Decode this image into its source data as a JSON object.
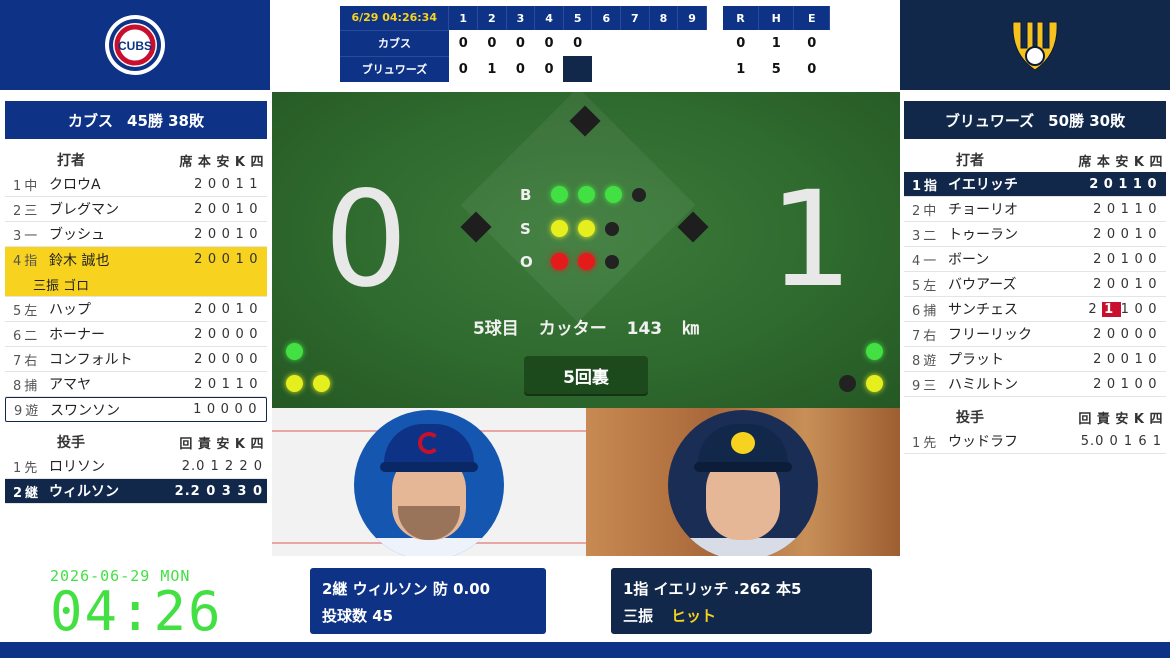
{
  "header": {
    "time": "6/29 04:26:34",
    "innings": [
      "1",
      "2",
      "3",
      "4",
      "5",
      "6",
      "7",
      "8",
      "9"
    ],
    "rhe": [
      "R",
      "H",
      "E"
    ]
  },
  "linescore": [
    {
      "team": "カブス",
      "innings": [
        "0",
        "0",
        "0",
        "0",
        "0",
        "",
        "",
        "",
        ""
      ],
      "r": "0",
      "h": "1",
      "e": "0"
    },
    {
      "team": "ブリュワーズ",
      "innings": [
        "0",
        "1",
        "0",
        "0",
        "",
        "",
        "",
        "",
        ""
      ],
      "r": "1",
      "h": "5",
      "e": "0"
    }
  ],
  "away": {
    "name": "カブス",
    "record": "45勝 38敗",
    "logo_text": "CUBS",
    "color": "#0e3386",
    "header_batter": "打者",
    "header_cols": "席 本 安 K 四",
    "batters": [
      {
        "pos": "1中",
        "name": "クロウA",
        "stats": "20011"
      },
      {
        "pos": "2三",
        "name": "ブレグマン",
        "stats": "20010"
      },
      {
        "pos": "3一",
        "name": "ブッシュ",
        "stats": "20010"
      },
      {
        "pos": "4指",
        "name": "鈴木 誠也",
        "stats": "20010"
      },
      {
        "pos": "5左",
        "name": "ハップ",
        "stats": "20010"
      },
      {
        "pos": "6二",
        "name": "ホーナー",
        "stats": "20000"
      },
      {
        "pos": "7右",
        "name": "コンフォルト",
        "stats": "20000"
      },
      {
        "pos": "8捕",
        "name": "アマヤ",
        "stats": "20110"
      },
      {
        "pos": "9遊",
        "name": "スワンソン",
        "stats": "10000"
      }
    ],
    "sub_note": "三振 ゴロ",
    "header_pitcher": "投手",
    "pitcher_cols": "回 責 安 K 四",
    "pitchers": [
      {
        "pos": "1先",
        "name": "ロリソン",
        "stats": "2.0 1 2 2 0"
      },
      {
        "pos": "2継",
        "name": "ウィルソン",
        "stats": "2.2 0 3 3 0"
      }
    ]
  },
  "home": {
    "name": "ブリュワーズ",
    "record": "50勝 30敗",
    "color": "#12284b",
    "header_batter": "打者",
    "header_cols": "席 本 安 K 四",
    "batters": [
      {
        "pos": "1指",
        "name": "イエリッチ",
        "stats": "20110"
      },
      {
        "pos": "2中",
        "name": "チョーリオ",
        "stats": "20110"
      },
      {
        "pos": "3二",
        "name": "トゥーラン",
        "stats": "20010"
      },
      {
        "pos": "4一",
        "name": "ボーン",
        "stats": "20100"
      },
      {
        "pos": "5左",
        "name": "バウアーズ",
        "stats": "20010"
      },
      {
        "pos": "6捕",
        "name": "サンチェス",
        "stats_a": "2",
        "stats_red": "1",
        "stats_b": "100"
      },
      {
        "pos": "7右",
        "name": "フリーリック",
        "stats": "20000"
      },
      {
        "pos": "8遊",
        "name": "プラット",
        "stats": "20010"
      },
      {
        "pos": "9三",
        "name": "ハミルトン",
        "stats": "20100"
      }
    ],
    "header_pitcher": "投手",
    "pitcher_cols": "回 責 安 K 四",
    "pitchers": [
      {
        "pos": "1先",
        "name": "ウッドラフ",
        "stats": "5.0 0 1 6 1"
      }
    ]
  },
  "field": {
    "score_away": "0",
    "score_home": "1",
    "labels": {
      "b": "B",
      "s": "S",
      "o": "O"
    },
    "balls": 3,
    "strikes": 2,
    "outs": 2,
    "pitch_info": "5球目 カッター 143 ㎞",
    "inning": "5回裏"
  },
  "cards": {
    "pitcher_line1": "2継 ウィルソン 防 0.00",
    "pitcher_line2": "投球数 45",
    "batter_line1": "1指 イエリッチ .262 本5",
    "batter_result1": "三振",
    "batter_result2": "ヒット"
  },
  "clock": {
    "date": "2026-06-29 MON",
    "time": "04:26"
  },
  "colors": {
    "cubs_blue": "#0e3386",
    "brewers_navy": "#12284b",
    "highlight_yellow": "#f7d21e",
    "clock_green": "#43e043",
    "field_green": "#2f6a2e"
  }
}
